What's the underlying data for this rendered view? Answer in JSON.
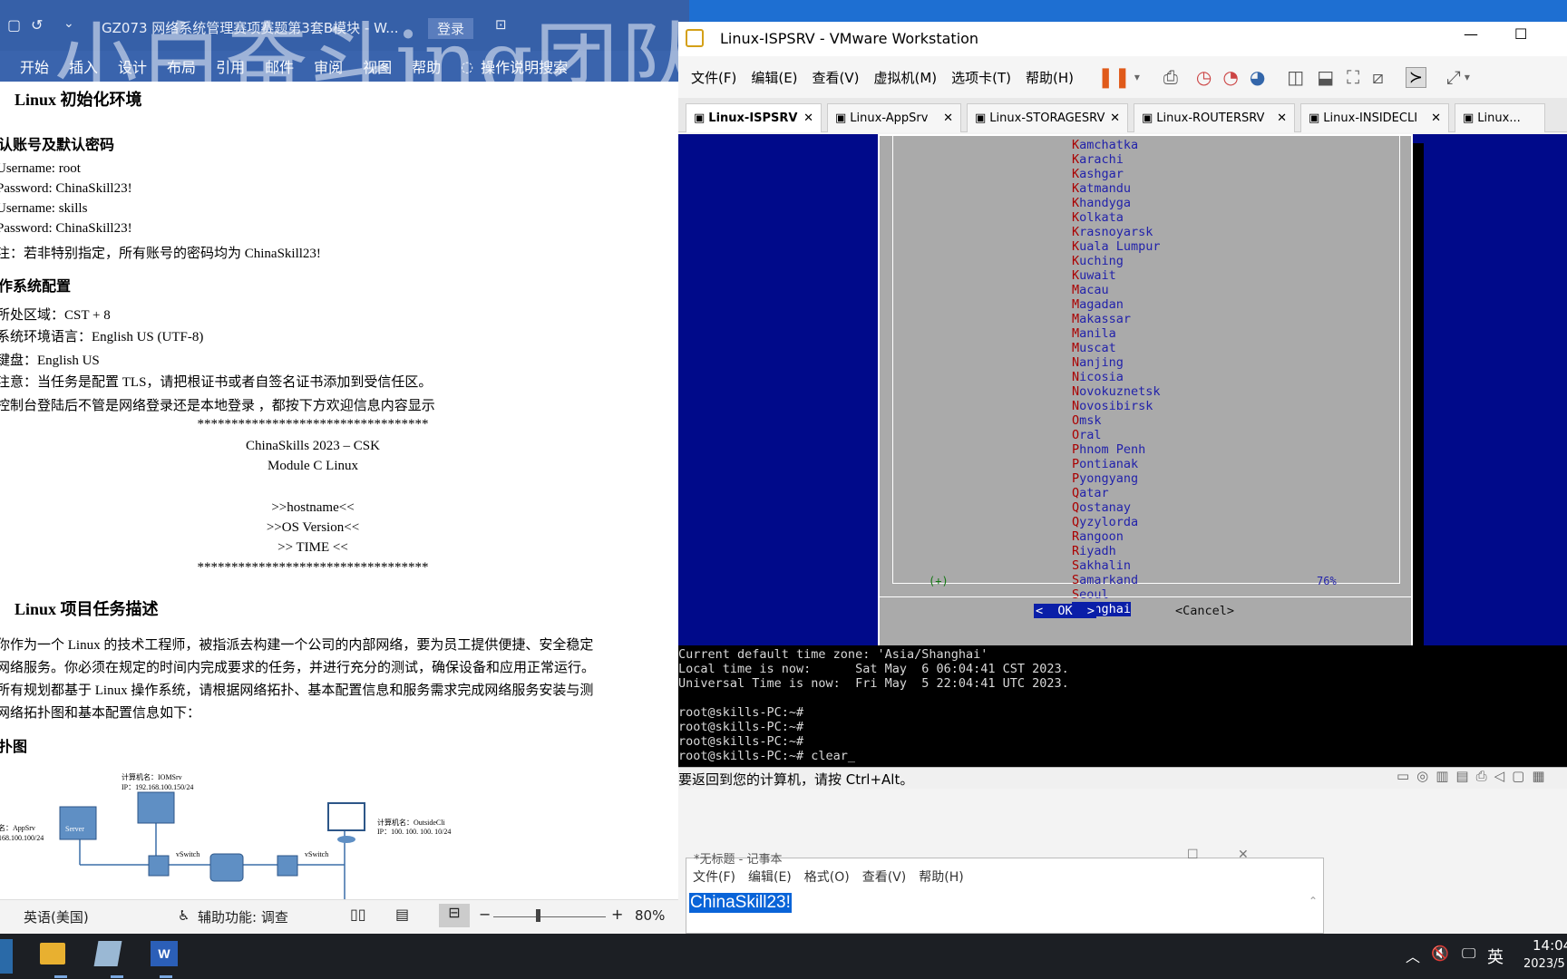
{
  "word": {
    "title": "GZ073 网络系统管理赛项赛题第3套B模块 - W...",
    "login": "登录",
    "watermark": "小白奋斗ing团队",
    "ribbon": [
      "开始",
      "插入",
      "设计",
      "布局",
      "引用",
      "邮件",
      "审阅",
      "视图",
      "帮助",
      "操作说明搜索"
    ],
    "doc": {
      "h1": "Linux 初始化环境",
      "h2a": "认账号及默认密码",
      "lines_a": [
        "Username: root",
        "Password: ChinaSkill23!",
        "Username: skills",
        "Password: ChinaSkill23!",
        "注：若非特别指定，所有账号的密码均为  ChinaSkill23!"
      ],
      "h2b": "作系统配置",
      "lines_b": [
        "所处区域：CST + 8",
        "系统环境语言：English US (UTF-8)",
        "键盘：English US",
        "注意：当任务是配置 TLS，请把根证书或者自签名证书添加到受信任区。",
        "控制台登陆后不管是网络登录还是本地登录 ，都按下方欢迎信息内容显示"
      ],
      "stars": "**********************************",
      "center": [
        "ChinaSkills 2023 – CSK",
        "Module C Linux",
        "",
        ">>hostname<<",
        ">>OS Version<<",
        ">> TIME <<"
      ],
      "h1b": "Linux 项目任务描述",
      "para": [
        "你作为一个 Linux 的技术工程师，被指派去构建一个公司的内部网络，要为员工提供便捷、安全稳定",
        "网络服务。你必须在规定的时间内完成要求的任务，并进行充分的测试，确保设备和应用正常运行。",
        "所有规划都基于 Linux 操作系统，请根据网络拓扑、基本配置信息和服务需求完成网络服务安装与测",
        "网络拓扑图和基本配置信息如下："
      ],
      "h2c": "扑图",
      "diagram": {
        "top_name": "计算机名：IOMSrv",
        "top_ip": "IP：192.168.100.150/24",
        "left_name": "名：AppSrv",
        "left_ip": "168.100.100/24",
        "right_name": "计算机名：OutsideCli",
        "right_ip": "IP：100. 100. 100. 10/24",
        "sw1": "vSwitch",
        "sw2": "vSwitch",
        "server": "Server"
      }
    },
    "status": {
      "lang": "英语(美国)",
      "access": "辅助功能: 调查",
      "zoom": "80%"
    }
  },
  "vmware": {
    "title": "Linux-ISPSRV - VMware Workstation",
    "menu": [
      "文件(F)",
      "编辑(E)",
      "查看(V)",
      "虚拟机(M)",
      "选项卡(T)",
      "帮助(H)"
    ],
    "tabs": [
      "Linux-ISPSRV",
      "Linux-AppSrv",
      "Linux-STORAGESRV",
      "Linux-ROUTERSRV",
      "Linux-INSIDECLI",
      "Linux..."
    ],
    "timezones": [
      "Kamchatka",
      "Karachi",
      "Kashgar",
      "Katmandu",
      "Khandyga",
      "Kolkata",
      "Krasnoyarsk",
      "Kuala Lumpur",
      "Kuching",
      "Kuwait",
      "Macau",
      "Magadan",
      "Makassar",
      "Manila",
      "Muscat",
      "Nanjing",
      "Nicosia",
      "Novokuznetsk",
      "Novosibirsk",
      "Omsk",
      "Oral",
      "Phnom Penh",
      "Pontianak",
      "Pyongyang",
      "Qatar",
      "Qostanay",
      "Qyzylorda",
      "Rangoon",
      "Riyadh",
      "Sakhalin",
      "Samarkand",
      "Seoul",
      "Shanghai"
    ],
    "scroll_more": "(+)",
    "scroll_pct": "76%",
    "ok": "<  OK  >",
    "cancel": "<Cancel>",
    "terminal": [
      "Current default time zone: 'Asia/Shanghai'",
      "Local time is now:      Sat May  6 06:04:41 CST 2023.",
      "Universal Time is now:  Fri May  5 22:04:41 UTC 2023.",
      "",
      "root@skills-PC:~#",
      "root@skills-PC:~#",
      "root@skills-PC:~#",
      "root@skills-PC:~# clear_"
    ],
    "hint": "要返回到您的计算机，请按 Ctrl+Alt。"
  },
  "notepad": {
    "title": "*无标题 - 记事本",
    "menu": [
      "文件(F)",
      "编辑(E)",
      "格式(O)",
      "查看(V)",
      "帮助(H)"
    ],
    "text": "ChinaSkill23!"
  },
  "taskbar": {
    "ime": "英",
    "time": "14:04",
    "date": "2023/5"
  }
}
